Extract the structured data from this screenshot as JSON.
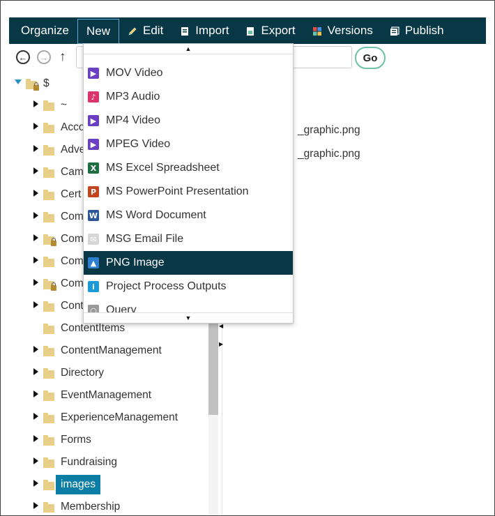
{
  "menubar": {
    "items": [
      {
        "label": "Organize",
        "icon": ""
      },
      {
        "label": "New",
        "icon": ""
      },
      {
        "label": "Edit",
        "icon": "pencil-icon"
      },
      {
        "label": "Import",
        "icon": "import-doc-icon"
      },
      {
        "label": "Export",
        "icon": "export-doc-icon"
      },
      {
        "label": "Versions",
        "icon": "versions-grid-icon"
      },
      {
        "label": "Publish",
        "icon": "publish-icon"
      }
    ],
    "active": "New",
    "bg_color": "#083746"
  },
  "toolbar": {
    "path_value": "",
    "go_label": "Go"
  },
  "tree": {
    "root_label": "$",
    "items": [
      {
        "label": "~",
        "expandable": true,
        "locked": false
      },
      {
        "label": "Acco",
        "expandable": true,
        "locked": false
      },
      {
        "label": "Adve",
        "expandable": true,
        "locked": false
      },
      {
        "label": "Cam",
        "expandable": true,
        "locked": false
      },
      {
        "label": "Cert",
        "expandable": true,
        "locked": false
      },
      {
        "label": "Com",
        "expandable": true,
        "locked": false
      },
      {
        "label": "Com",
        "expandable": true,
        "locked": true
      },
      {
        "label": "Com",
        "expandable": true,
        "locked": false
      },
      {
        "label": "Com",
        "expandable": true,
        "locked": true
      },
      {
        "label": "Cont",
        "expandable": true,
        "locked": false
      },
      {
        "label": "ContentItems",
        "expandable": false,
        "locked": false
      },
      {
        "label": "ContentManagement",
        "expandable": true,
        "locked": false
      },
      {
        "label": "Directory",
        "expandable": true,
        "locked": false
      },
      {
        "label": "EventManagement",
        "expandable": true,
        "locked": false
      },
      {
        "label": "ExperienceManagement",
        "expandable": true,
        "locked": false
      },
      {
        "label": "Forms",
        "expandable": true,
        "locked": false
      },
      {
        "label": "Fundraising",
        "expandable": true,
        "locked": false
      },
      {
        "label": "images",
        "expandable": true,
        "locked": false,
        "selected": true
      },
      {
        "label": "Membership",
        "expandable": true,
        "locked": false
      }
    ]
  },
  "content": {
    "files": [
      "_graphic.png",
      "_graphic.png"
    ]
  },
  "dropdown": {
    "items": [
      {
        "label": "MOV Video",
        "icon": "video-icon",
        "color": "#6a3fc1",
        "glyph": "▶"
      },
      {
        "label": "MP3 Audio",
        "icon": "audio-icon",
        "color": "#d9356a",
        "glyph": "♪"
      },
      {
        "label": "MP4 Video",
        "icon": "video-icon",
        "color": "#6a3fc1",
        "glyph": "▶"
      },
      {
        "label": "MPEG Video",
        "icon": "video-icon",
        "color": "#6a3fc1",
        "glyph": "▶"
      },
      {
        "label": "MS Excel Spreadsheet",
        "icon": "excel-icon",
        "color": "#1e6e42",
        "glyph": "X"
      },
      {
        "label": "MS PowerPoint Presentation",
        "icon": "powerpoint-icon",
        "color": "#c4441f",
        "glyph": "P"
      },
      {
        "label": "MS Word Document",
        "icon": "word-icon",
        "color": "#2b579a",
        "glyph": "W"
      },
      {
        "label": "MSG Email File",
        "icon": "email-icon",
        "color": "#d6d6d6",
        "glyph": "✉"
      },
      {
        "label": "PNG Image",
        "icon": "image-icon",
        "color": "#2f7fd1",
        "glyph": "▲",
        "highlighted": true
      },
      {
        "label": "Project Process Outputs",
        "icon": "info-icon",
        "color": "#1a9ad6",
        "glyph": "i"
      },
      {
        "label": "Query",
        "icon": "search-icon",
        "color": "#999999",
        "glyph": "○"
      }
    ],
    "highlight_color": "#083746"
  }
}
